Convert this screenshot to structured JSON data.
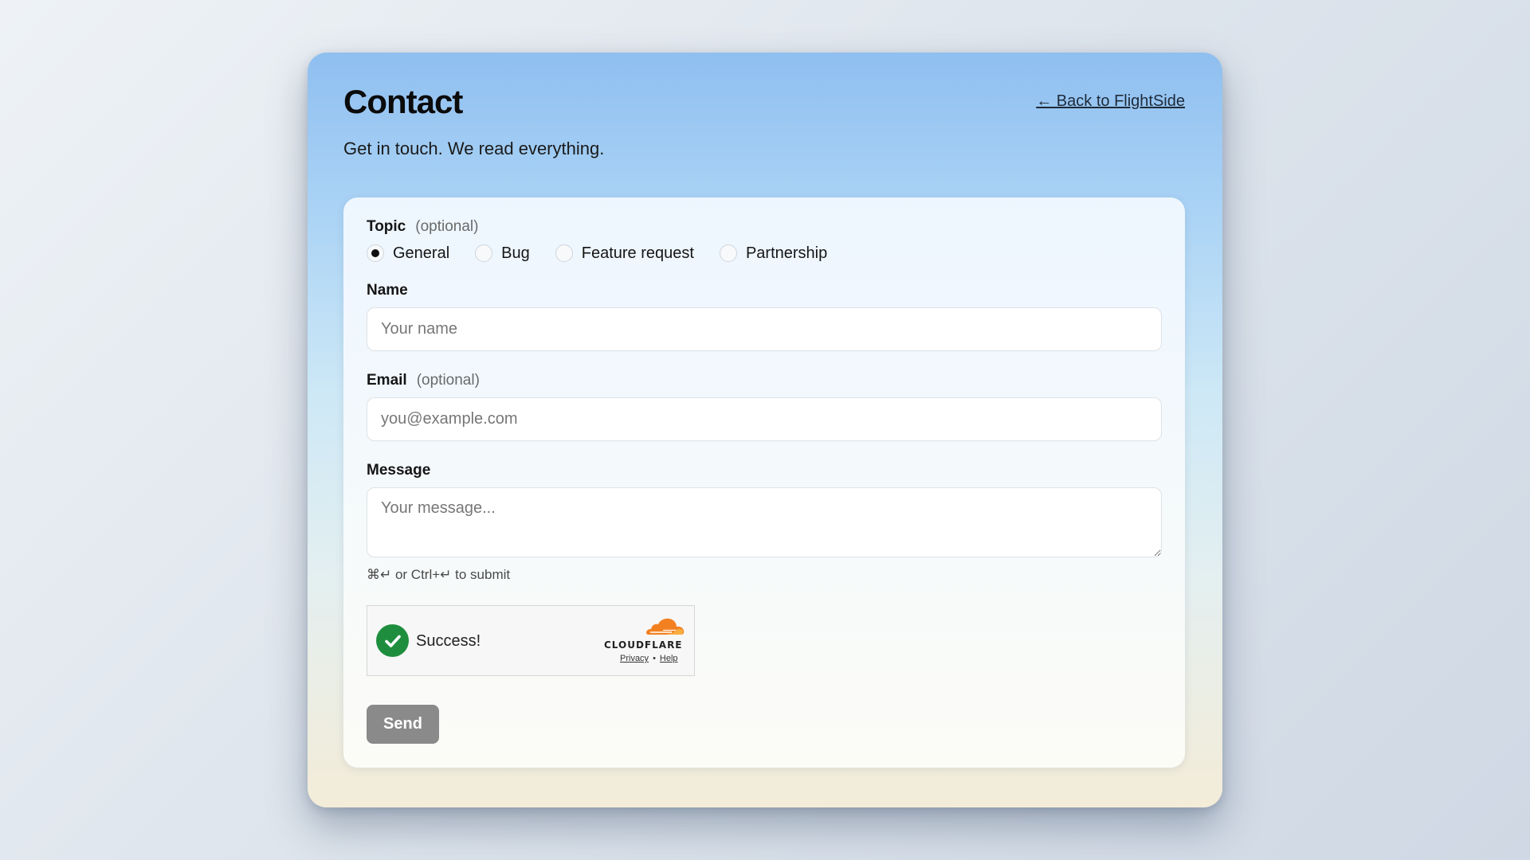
{
  "header": {
    "title": "Contact",
    "back_link": "← Back to FlightSide",
    "subtitle": "Get in touch. We read everything."
  },
  "form": {
    "topic": {
      "label": "Topic",
      "optional": "(optional)",
      "options": [
        {
          "label": "General",
          "checked": true
        },
        {
          "label": "Bug",
          "checked": false
        },
        {
          "label": "Feature request",
          "checked": false
        },
        {
          "label": "Partnership",
          "checked": false
        }
      ]
    },
    "name": {
      "label": "Name",
      "placeholder": "Your name",
      "value": ""
    },
    "email": {
      "label": "Email",
      "optional": "(optional)",
      "placeholder": "you@example.com",
      "value": ""
    },
    "message": {
      "label": "Message",
      "placeholder": "Your message...",
      "value": ""
    },
    "hint": "⌘↵ or Ctrl+↵ to submit",
    "captcha": {
      "status": "Success!",
      "brand": "CLOUDFLARE",
      "privacy": "Privacy",
      "separator": "•",
      "help": "Help",
      "brand_color": "#f38020",
      "success_color": "#1e8e3e"
    },
    "submit_label": "Send"
  }
}
